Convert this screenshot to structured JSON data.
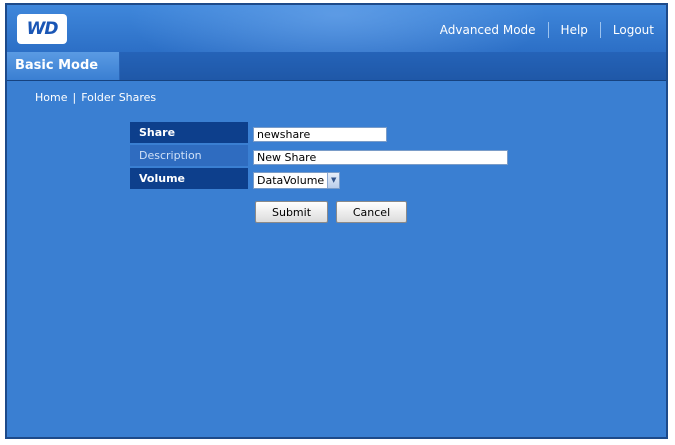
{
  "header": {
    "logo_text": "WD",
    "nav": {
      "advanced_mode": "Advanced Mode",
      "help": "Help",
      "logout": "Logout"
    }
  },
  "mode_tab": {
    "label": "Basic Mode"
  },
  "breadcrumb": {
    "home": "Home",
    "separator": "|",
    "current": "Folder Shares"
  },
  "form": {
    "share": {
      "label": "Share",
      "value": "newshare"
    },
    "description": {
      "label": "Description",
      "value": "New Share"
    },
    "volume": {
      "label": "Volume",
      "selected": "DataVolume"
    }
  },
  "buttons": {
    "submit": "Submit",
    "cancel": "Cancel"
  },
  "colors": {
    "background": "#3a7fd2",
    "header": "#2c6fc6",
    "label_dark": "#0d3f8c"
  }
}
